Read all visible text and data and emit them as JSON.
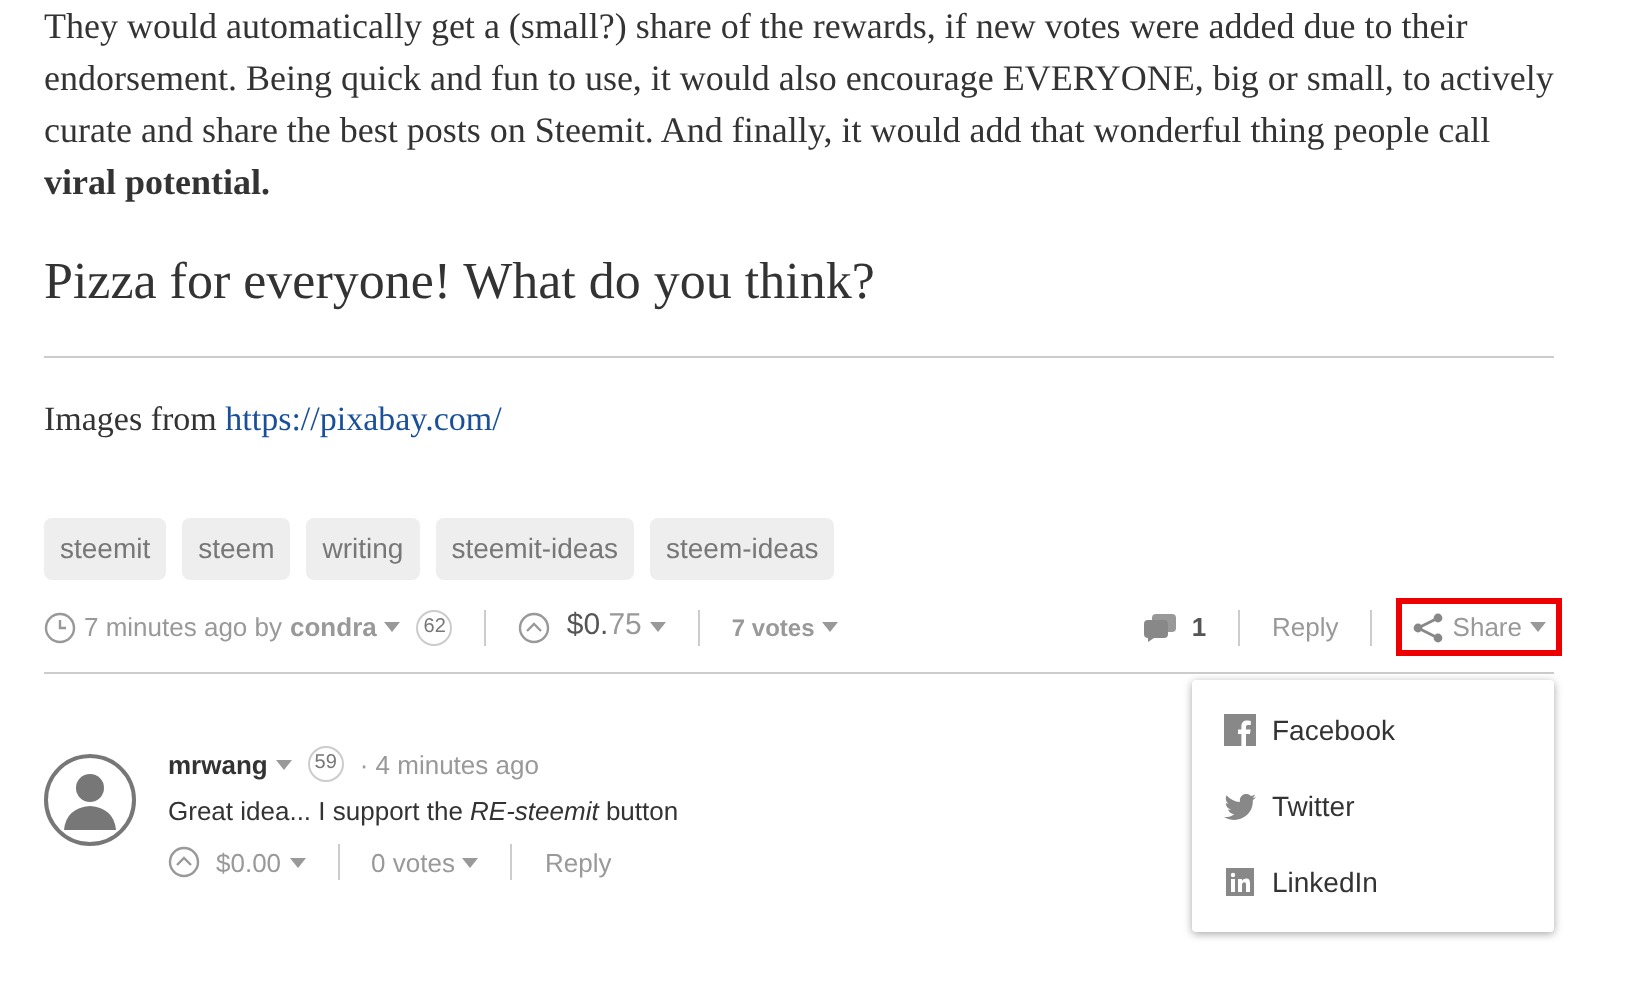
{
  "article": {
    "paragraph": "They would automatically get a (small?) share of the rewards, if new votes were added due to their endorsement. Being quick and fun to use, it would also encourage EVERYONE, big or small, to actively curate and share the best posts on Steemit. And finally, it would add that wonderful thing people call **viral potential.**",
    "heading": "Pizza for everyone! What do you think?",
    "credit_text": "Images from ",
    "credit_link": "https://pixabay.com/"
  },
  "tags": [
    "steemit",
    "steem",
    "writing",
    "steemit-ideas",
    "steem-ideas"
  ],
  "post_meta": {
    "time": "7 minutes ago by",
    "author": "condra",
    "reputation": "62",
    "payout_whole": "$0.",
    "payout_fraction": "75",
    "votes": "7 votes",
    "comments": "1",
    "reply": "Reply",
    "share": "Share",
    "share_highlighted": true
  },
  "share_menu": [
    {
      "label": "Facebook",
      "kind": "facebook"
    },
    {
      "label": "Twitter",
      "kind": "twitter"
    },
    {
      "label": "LinkedIn",
      "kind": "linkedin"
    }
  ],
  "comment": {
    "author": "mrwang",
    "reputation": "59",
    "time": "· 4 minutes ago",
    "text": "Great idea... I support the *RE-steemit* button",
    "payout_whole": "$0.",
    "payout_fraction": "00",
    "votes": "0 votes",
    "reply": "Reply"
  }
}
